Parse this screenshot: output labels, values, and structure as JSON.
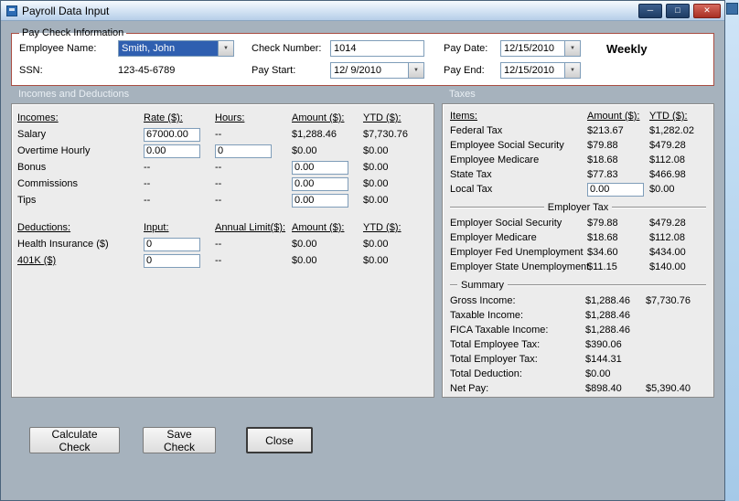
{
  "window": {
    "title": "Payroll Data Input"
  },
  "icons": {
    "dropdown_arrow": "▼",
    "minimize": "─",
    "maximize": "□",
    "close": "✕"
  },
  "paycheck": {
    "group_label": "Pay Check Information",
    "employee_name": {
      "label": "Employee Name:",
      "value": "Smith, John"
    },
    "ssn": {
      "label": "SSN:",
      "value": "123-45-6789"
    },
    "check_number": {
      "label": "Check Number:",
      "value": "1014"
    },
    "pay_start": {
      "label": "Pay Start:",
      "value": "12/ 9/2010"
    },
    "pay_date": {
      "label": "Pay Date:",
      "value": "12/15/2010"
    },
    "pay_end": {
      "label": "Pay End:",
      "value": "12/15/2010"
    },
    "frequency": "Weekly"
  },
  "sections": {
    "left": "Incomes and Deductions",
    "right": "Taxes"
  },
  "incomes_table": {
    "rows": [
      [
        {
          "k": "header",
          "v": "Incomes:"
        },
        {
          "k": "header",
          "v": "Rate ($):"
        },
        {
          "k": "header",
          "v": "Hours:"
        },
        {
          "k": "header",
          "v": "Amount ($):"
        },
        {
          "k": "header",
          "v": "YTD ($):"
        }
      ],
      [
        {
          "k": "label",
          "v": "Salary"
        },
        {
          "k": "input",
          "v": "67000.00",
          "n": "salary-rate-input"
        },
        {
          "k": "text",
          "v": "--"
        },
        {
          "k": "text",
          "v": "$1,288.46"
        },
        {
          "k": "text",
          "v": "$7,730.76"
        }
      ],
      [
        {
          "k": "label",
          "v": "Overtime Hourly"
        },
        {
          "k": "input",
          "v": "0.00",
          "n": "overtime-rate-input"
        },
        {
          "k": "input",
          "v": "0",
          "n": "overtime-hours-input"
        },
        {
          "k": "text",
          "v": "$0.00"
        },
        {
          "k": "text",
          "v": "$0.00"
        }
      ],
      [
        {
          "k": "label",
          "v": "Bonus"
        },
        {
          "k": "text",
          "v": "--"
        },
        {
          "k": "text",
          "v": "--"
        },
        {
          "k": "input",
          "v": "0.00",
          "n": "bonus-amount-input"
        },
        {
          "k": "text",
          "v": "$0.00"
        }
      ],
      [
        {
          "k": "label",
          "v": "Commissions"
        },
        {
          "k": "text",
          "v": "--"
        },
        {
          "k": "text",
          "v": "--"
        },
        {
          "k": "input",
          "v": "0.00",
          "n": "commissions-amount-input"
        },
        {
          "k": "text",
          "v": "$0.00"
        }
      ],
      [
        {
          "k": "label",
          "v": "Tips"
        },
        {
          "k": "text",
          "v": "--"
        },
        {
          "k": "text",
          "v": "--"
        },
        {
          "k": "input",
          "v": "0.00",
          "n": "tips-amount-input"
        },
        {
          "k": "text",
          "v": "$0.00"
        }
      ]
    ]
  },
  "deductions_table": {
    "rows": [
      [
        {
          "k": "header",
          "v": "Deductions:"
        },
        {
          "k": "header",
          "v": "Input:"
        },
        {
          "k": "header",
          "v": "Annual Limit($):"
        },
        {
          "k": "header",
          "v": "Amount ($):"
        },
        {
          "k": "header",
          "v": "YTD ($):"
        }
      ],
      [
        {
          "k": "label",
          "v": "Health Insurance ($)"
        },
        {
          "k": "input",
          "v": "0",
          "n": "health-insurance-input"
        },
        {
          "k": "text",
          "v": "--"
        },
        {
          "k": "text",
          "v": "$0.00"
        },
        {
          "k": "text",
          "v": "$0.00"
        }
      ],
      [
        {
          "k": "link",
          "v": "401K ($)",
          "n": "401k-link"
        },
        {
          "k": "input",
          "v": "0",
          "n": "401k-input"
        },
        {
          "k": "text",
          "v": "--"
        },
        {
          "k": "text",
          "v": "$0.00"
        },
        {
          "k": "text",
          "v": "$0.00"
        }
      ]
    ]
  },
  "taxes_table": {
    "rows": [
      [
        {
          "k": "header",
          "v": "Items:"
        },
        {
          "k": "header",
          "v": "Amount ($):"
        },
        {
          "k": "header",
          "v": "YTD ($):"
        }
      ],
      [
        {
          "k": "label",
          "v": "Federal Tax"
        },
        {
          "k": "text",
          "v": "$213.67"
        },
        {
          "k": "text",
          "v": "$1,282.02"
        }
      ],
      [
        {
          "k": "label",
          "v": "Employee Social Security"
        },
        {
          "k": "text",
          "v": "$79.88"
        },
        {
          "k": "text",
          "v": "$479.28"
        }
      ],
      [
        {
          "k": "label",
          "v": "Employee Medicare"
        },
        {
          "k": "text",
          "v": "$18.68"
        },
        {
          "k": "text",
          "v": "$112.08"
        }
      ],
      [
        {
          "k": "label",
          "v": "State Tax"
        },
        {
          "k": "text",
          "v": "$77.83"
        },
        {
          "k": "text",
          "v": "$466.98"
        }
      ],
      [
        {
          "k": "label",
          "v": "Local Tax"
        },
        {
          "k": "input",
          "v": "0.00",
          "n": "local-tax-input"
        },
        {
          "k": "text",
          "v": "$0.00"
        }
      ]
    ],
    "employer_group_label": "Employer Tax",
    "employer_rows": [
      [
        {
          "k": "label",
          "v": "Employer Social Security"
        },
        {
          "k": "text",
          "v": "$79.88"
        },
        {
          "k": "text",
          "v": "$479.28"
        }
      ],
      [
        {
          "k": "label",
          "v": "Employer Medicare"
        },
        {
          "k": "text",
          "v": "$18.68"
        },
        {
          "k": "text",
          "v": "$112.08"
        }
      ],
      [
        {
          "k": "label",
          "v": "Employer Fed Unemployment"
        },
        {
          "k": "text",
          "v": "$34.60"
        },
        {
          "k": "text",
          "v": "$434.00"
        }
      ],
      [
        {
          "k": "label",
          "v": "Employer State Unemployment"
        },
        {
          "k": "text",
          "v": "$11.15"
        },
        {
          "k": "text",
          "v": "$140.00"
        }
      ]
    ]
  },
  "summary": {
    "group_label": "Summary",
    "rows": [
      [
        {
          "k": "label",
          "v": "Gross Income:"
        },
        {
          "k": "text",
          "v": "$1,288.46"
        },
        {
          "k": "text",
          "v": "$7,730.76"
        }
      ],
      [
        {
          "k": "label",
          "v": "Taxable Income:"
        },
        {
          "k": "text",
          "v": "$1,288.46"
        },
        {
          "k": "text",
          "v": ""
        }
      ],
      [
        {
          "k": "label",
          "v": "FICA Taxable Income:"
        },
        {
          "k": "text",
          "v": "$1,288.46"
        },
        {
          "k": "text",
          "v": ""
        }
      ],
      [
        {
          "k": "label",
          "v": "Total Employee Tax:"
        },
        {
          "k": "text",
          "v": "$390.06"
        },
        {
          "k": "text",
          "v": ""
        }
      ],
      [
        {
          "k": "label",
          "v": "Total Employer Tax:"
        },
        {
          "k": "text",
          "v": "$144.31"
        },
        {
          "k": "text",
          "v": ""
        }
      ],
      [
        {
          "k": "label",
          "v": "Total Deduction:"
        },
        {
          "k": "text",
          "v": "$0.00"
        },
        {
          "k": "text",
          "v": ""
        }
      ],
      [
        {
          "k": "label",
          "v": "Net Pay:"
        },
        {
          "k": "text",
          "v": "$898.40"
        },
        {
          "k": "text",
          "v": "$5,390.40"
        }
      ]
    ]
  },
  "buttons": {
    "calculate": "Calculate Check",
    "save": "Save Check",
    "close": "Close"
  }
}
